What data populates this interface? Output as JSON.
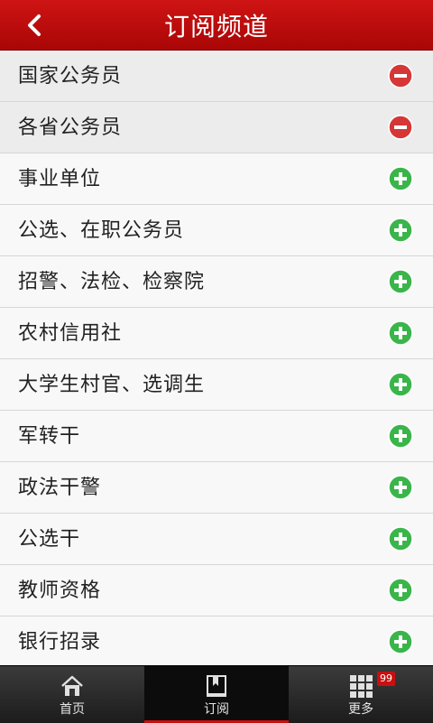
{
  "header": {
    "title": "订阅频道"
  },
  "channels": [
    {
      "label": "国家公务员",
      "subscribed": true
    },
    {
      "label": "各省公务员",
      "subscribed": true
    },
    {
      "label": "事业单位",
      "subscribed": false
    },
    {
      "label": "公选、在职公务员",
      "subscribed": false
    },
    {
      "label": "招警、法检、检察院",
      "subscribed": false
    },
    {
      "label": "农村信用社",
      "subscribed": false
    },
    {
      "label": "大学生村官、选调生",
      "subscribed": false
    },
    {
      "label": "军转干",
      "subscribed": false
    },
    {
      "label": "政法干警",
      "subscribed": false
    },
    {
      "label": "公选干",
      "subscribed": false
    },
    {
      "label": "教师资格",
      "subscribed": false
    },
    {
      "label": "银行招录",
      "subscribed": false
    }
  ],
  "tabs": [
    {
      "label": "首页",
      "icon": "home-icon"
    },
    {
      "label": "订阅",
      "icon": "book-icon",
      "active": true
    },
    {
      "label": "更多",
      "icon": "grid-icon",
      "badge": "99"
    }
  ],
  "colors": {
    "header": "#b80b0b",
    "remove": "#d63636",
    "add": "#3ab54a"
  }
}
